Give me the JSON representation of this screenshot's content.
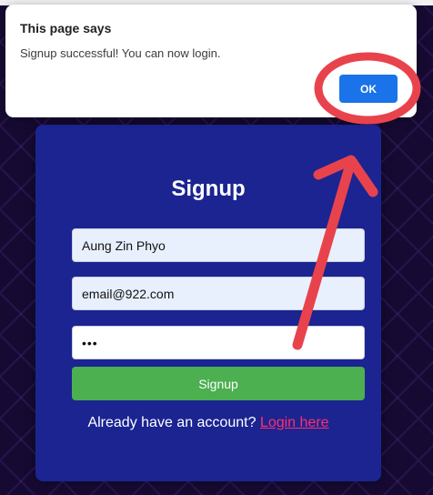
{
  "dialog": {
    "title": "This page says",
    "message": "Signup successful! You can now login.",
    "ok_label": "OK"
  },
  "form": {
    "title": "Signup",
    "name_value": "Aung Zin Phyo",
    "email_value": "email@922.com",
    "password_value": "•••",
    "submit_label": "Signup",
    "login_prompt": "Already have an account?",
    "login_link": "Login here"
  },
  "colors": {
    "card_bg": "#1b2491",
    "submit_bg": "#4caf50",
    "link": "#ff2f6b",
    "ok_button": "#1a73e8",
    "annotation": "#e8434c"
  },
  "annotation": {
    "shapes": [
      "circle-around-ok-button",
      "arrow-pointing-to-ok-button"
    ]
  }
}
